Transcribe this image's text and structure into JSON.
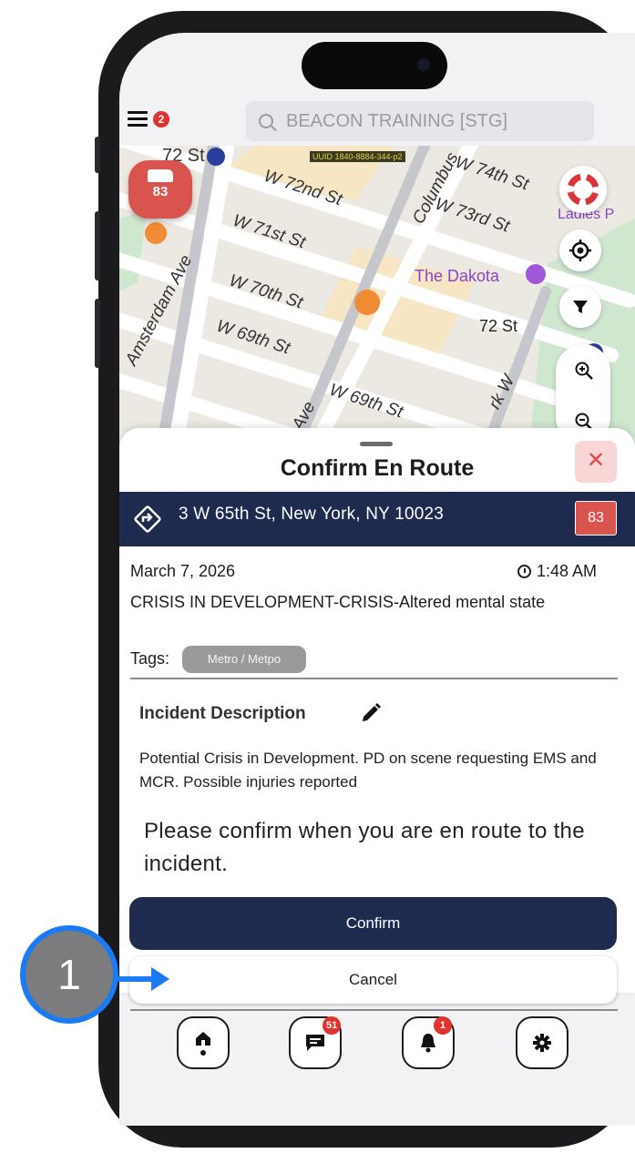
{
  "topbar": {
    "menu_badge": "2",
    "search_placeholder": "BEACON TRAINING [STG]"
  },
  "map": {
    "uid_text": "UUID 1840-8884-344-p2",
    "streets": [
      "72 St",
      "W 72nd St",
      "W 71st St",
      "W 70th St",
      "W 69th St",
      "W 69th St",
      "Amsterdam Ave",
      "Columbus",
      "W 74th St",
      "W 73rd St",
      "Ave",
      "rk W"
    ],
    "places": [
      "The Dakota",
      "Ladies P"
    ],
    "station": "72 St",
    "unit_marker_number": "83",
    "fab_icons": [
      "lifebuoy-icon",
      "locate-icon",
      "filter-icon",
      "zoom-in-icon",
      "zoom-out-icon"
    ]
  },
  "sheet": {
    "title": "Confirm En Route",
    "close_label": "✕",
    "address": "3 W 65th St, New York, NY 10023",
    "unit_number": "83",
    "date": "March 7, 2026",
    "time": "1:48 AM",
    "incident_type": "CRISIS IN DEVELOPMENT-CRISIS-Altered mental state",
    "tags_label": "Tags:",
    "tag": "Metro / Metpo",
    "description_title": "Incident Description",
    "description": "Potential Crisis in Development. PD on scene requesting EMS and MCR. Possible injuries reported",
    "prompt": "Please confirm when you are en route to the incident.",
    "confirm_label": "Confirm",
    "cancel_label": "Cancel"
  },
  "tabs": [
    {
      "name": "home",
      "icon": "home-icon",
      "badge": ""
    },
    {
      "name": "messages",
      "icon": "chat-icon",
      "badge": "51"
    },
    {
      "name": "alerts",
      "icon": "bell-icon",
      "badge": "1"
    },
    {
      "name": "settings",
      "icon": "gear-icon",
      "badge": ""
    }
  ],
  "annotation": {
    "step_number": "1"
  },
  "colors": {
    "navy": "#1f2a4f",
    "alert_red": "#d9534f",
    "badge_red": "#e0322f",
    "annotation_blue": "#1a7bf2"
  }
}
